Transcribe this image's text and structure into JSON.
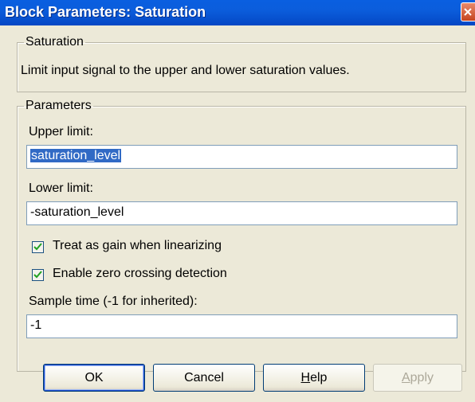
{
  "window": {
    "title": "Block Parameters: Saturation"
  },
  "block_group": {
    "legend": "Saturation",
    "description": "Limit input signal to the upper and lower saturation values."
  },
  "params_group": {
    "legend": "Parameters"
  },
  "upper_limit": {
    "label": "Upper limit:",
    "value": "saturation_level"
  },
  "lower_limit": {
    "label": "Lower limit:",
    "value": "-saturation_level"
  },
  "treat_gain": {
    "label": "Treat as gain when linearizing",
    "checked": true
  },
  "zero_crossing": {
    "label": "Enable zero crossing detection",
    "checked": true
  },
  "sample_time": {
    "label": "Sample time (-1 for inherited):",
    "value": "-1"
  },
  "buttons": {
    "ok": "OK",
    "cancel": "Cancel",
    "help_prefix": "H",
    "help_rest": "elp",
    "apply_prefix": "A",
    "apply_rest": "pply"
  },
  "icons": {
    "close": "close-icon",
    "checkmark": "checkmark-icon"
  },
  "colors": {
    "titlebar": "#0a5fe0",
    "selection": "#316ac5",
    "dialog_bg": "#ece9d8"
  }
}
